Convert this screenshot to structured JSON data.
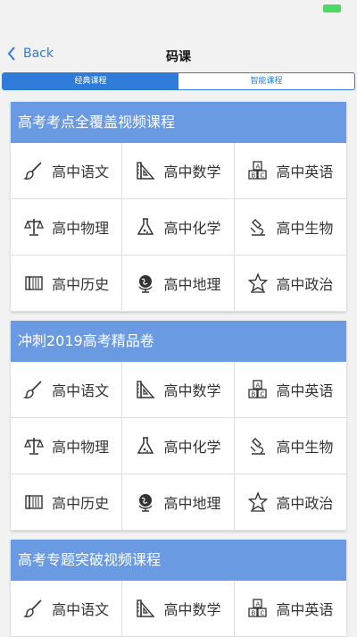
{
  "colors": {
    "accent": "#2f7bd8",
    "section_header": "#6a9ae2",
    "battery": "#4cd964"
  },
  "status_bar": {
    "battery_icon": "battery-icon"
  },
  "nav": {
    "back_label": "Back",
    "title": "码课"
  },
  "tabs": [
    {
      "label": "经典课程",
      "active": true
    },
    {
      "label": "智能课程",
      "active": false
    }
  ],
  "sections": [
    {
      "title": "高考考点全覆盖视频课程",
      "subjects": [
        {
          "label": "高中语文",
          "icon": "brush-icon"
        },
        {
          "label": "高中数学",
          "icon": "ruler-icon"
        },
        {
          "label": "高中英语",
          "icon": "abc-blocks-icon"
        },
        {
          "label": "高中物理",
          "icon": "balance-scale-icon"
        },
        {
          "label": "高中化学",
          "icon": "flask-icon"
        },
        {
          "label": "高中生物",
          "icon": "microscope-icon"
        },
        {
          "label": "高中历史",
          "icon": "scroll-icon"
        },
        {
          "label": "高中地理",
          "icon": "globe-icon"
        },
        {
          "label": "高中政治",
          "icon": "star-badge-icon"
        }
      ]
    },
    {
      "title": "冲刺2019高考精品卷",
      "subjects": [
        {
          "label": "高中语文",
          "icon": "brush-icon"
        },
        {
          "label": "高中数学",
          "icon": "ruler-icon"
        },
        {
          "label": "高中英语",
          "icon": "abc-blocks-icon"
        },
        {
          "label": "高中物理",
          "icon": "balance-scale-icon"
        },
        {
          "label": "高中化学",
          "icon": "flask-icon"
        },
        {
          "label": "高中生物",
          "icon": "microscope-icon"
        },
        {
          "label": "高中历史",
          "icon": "scroll-icon"
        },
        {
          "label": "高中地理",
          "icon": "globe-icon"
        },
        {
          "label": "高中政治",
          "icon": "star-badge-icon"
        }
      ]
    },
    {
      "title": "高考专题突破视频课程",
      "subjects": [
        {
          "label": "高中语文",
          "icon": "brush-icon"
        },
        {
          "label": "高中数学",
          "icon": "ruler-icon"
        },
        {
          "label": "高中英语",
          "icon": "abc-blocks-icon"
        }
      ]
    }
  ]
}
